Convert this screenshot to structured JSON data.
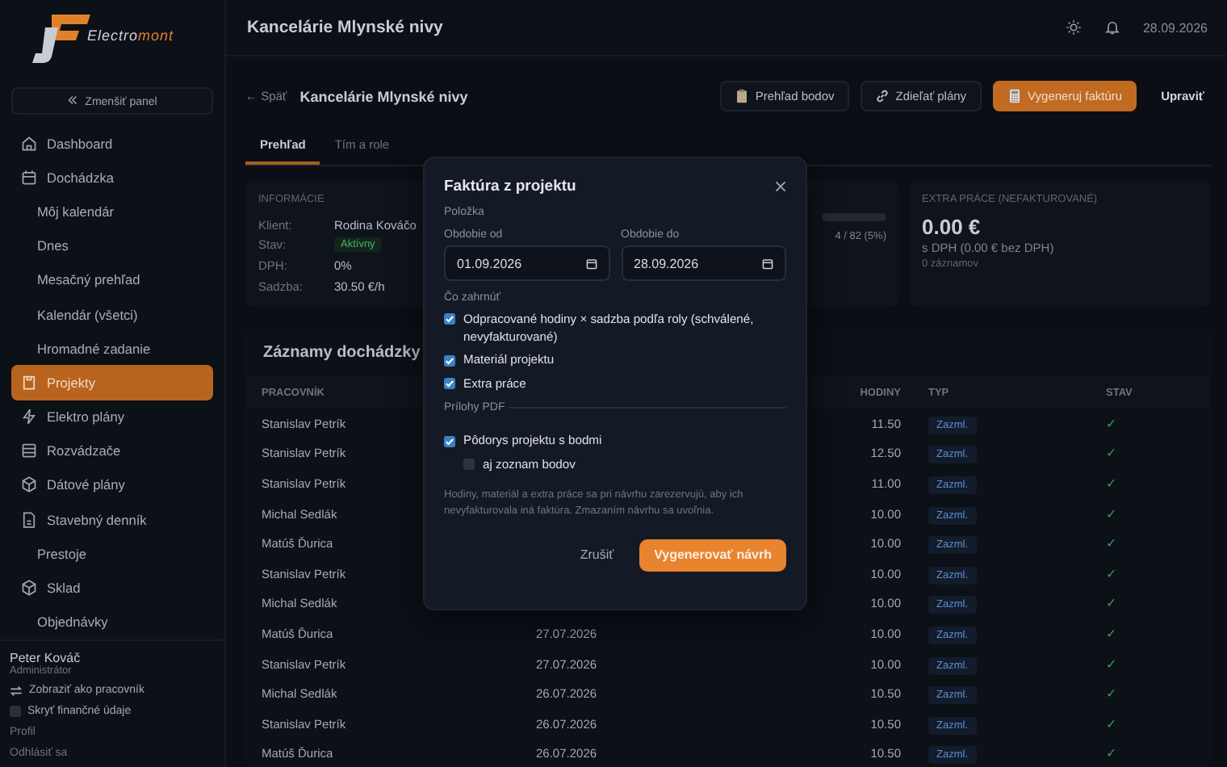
{
  "logo": {
    "name_start": "Electro",
    "name_end": "mont"
  },
  "sidebar": {
    "collapse_button": "Zmenšiť panel",
    "items": [
      {
        "label": "Dashboard",
        "kind": "section",
        "selected": false
      },
      {
        "label": "Dochádzka",
        "kind": "section",
        "selected": false
      },
      {
        "label": "Môj kalendár",
        "kind": "sub",
        "selected": false
      },
      {
        "label": "Dnes",
        "kind": "sub",
        "selected": false
      },
      {
        "label": "Mesačný prehľad",
        "kind": "sub",
        "selected": false
      },
      {
        "label": "Kalendár (všetci)",
        "kind": "sub",
        "selected": false
      },
      {
        "label": "Hromadné zadanie",
        "kind": "sub",
        "selected": false
      },
      {
        "label": "Projekty",
        "kind": "section",
        "selected": true
      },
      {
        "label": "Elektro plány",
        "kind": "section",
        "selected": false
      },
      {
        "label": "Rozvádzače",
        "kind": "section",
        "selected": false
      },
      {
        "label": "Dátové plány",
        "kind": "section",
        "selected": false
      },
      {
        "label": "Stavebný denník",
        "kind": "section",
        "selected": false
      },
      {
        "label": "Prestoje",
        "kind": "sub",
        "selected": false
      },
      {
        "label": "Sklad",
        "kind": "section",
        "selected": false
      },
      {
        "label": "Objednávky",
        "kind": "sub",
        "selected": false
      }
    ],
    "user": {
      "name": "Peter Kováč",
      "role": "Administrátor",
      "switch_link": "Zobraziť ako pracovník",
      "hide_finance": {
        "label": "Skryť finančné údaje",
        "checked": false
      },
      "profile_link": "Profil",
      "logout_link": "Odhlásiť sa"
    }
  },
  "topbar": {
    "title": "Kancelárie Mlynské nivy",
    "date": "28.09.2026"
  },
  "header": {
    "back": "← Späť",
    "title": "Kancelárie Mlynské nivy",
    "buttons": [
      {
        "label": "Prehľad bodov",
        "kind": "clipboard"
      },
      {
        "label": "Zdieľať plány",
        "kind": "link"
      },
      {
        "label": "Vygeneruj faktúru",
        "kind": "primary"
      },
      {
        "label": "Upraviť",
        "kind": "plain"
      }
    ]
  },
  "tabs": [
    {
      "label": "Prehľad",
      "selected": true
    },
    {
      "label": "Tím a role",
      "selected": false
    }
  ],
  "info_card": {
    "heading": "INFORMÁCIE",
    "rows": [
      {
        "label": "Klient:",
        "value": "Rodina Kováčo",
        "kind": "text"
      },
      {
        "label": "Stav:",
        "value": "Aktívny",
        "kind": "badge"
      },
      {
        "label": "DPH:",
        "value": "0%",
        "kind": "text"
      },
      {
        "label": "Sadzba:",
        "value": "30.50 €/h",
        "kind": "text"
      }
    ]
  },
  "progress_card": {
    "caption": "4 / 82 (5%)"
  },
  "extra_card": {
    "heading": "EXTRA PRÁCE (NEFAKTUROVANÉ)",
    "amount": "0.00 €",
    "sub": "s DPH (0.00 € bez DPH)",
    "count": "0 záznamov"
  },
  "table": {
    "title": "Záznamy dochádzky",
    "columns": [
      "PRACOVNÍK",
      "HODINY",
      "TYP",
      "STAV"
    ],
    "rows": [
      {
        "worker": "Stanislav Petrík",
        "hours": "11.50",
        "type": "Zazml.",
        "status": "✓"
      },
      {
        "worker": "Stanislav Petrík",
        "hours": "12.50",
        "type": "Zazml.",
        "status": "✓"
      },
      {
        "worker": "Stanislav Petrík",
        "hours": "11.00",
        "type": "Zazml.",
        "status": "✓"
      },
      {
        "worker": "Michal Sedlák",
        "hours": "10.00",
        "type": "Zazml.",
        "status": "✓"
      },
      {
        "worker": "Matúš Ďurica",
        "hours": "10.00",
        "type": "Zazml.",
        "status": "✓"
      },
      {
        "worker": "Stanislav Petrík",
        "hours": "10.00",
        "type": "Zazml.",
        "status": "✓"
      },
      {
        "worker": "Michal Sedlák",
        "hours": "10.00",
        "type": "Zazml.",
        "status": "✓"
      },
      {
        "worker": "Matúš Ďurica",
        "date": "27.07.2026",
        "hours": "10.00",
        "type": "Zazml.",
        "status": "✓"
      },
      {
        "worker": "Stanislav Petrík",
        "date": "27.07.2026",
        "hours": "10.00",
        "type": "Zazml.",
        "status": "✓"
      },
      {
        "worker": "Michal Sedlák",
        "date": "26.07.2026",
        "hours": "10.50",
        "type": "Zazml.",
        "status": "✓"
      },
      {
        "worker": "Stanislav Petrík",
        "date": "26.07.2026",
        "hours": "10.50",
        "type": "Zazml.",
        "status": "✓"
      },
      {
        "worker": "Matúš Ďurica",
        "date": "26.07.2026",
        "hours": "10.50",
        "type": "Zazml.",
        "status": "✓"
      }
    ]
  },
  "modal": {
    "title": "Faktúra z projektu",
    "section_item": "Položka",
    "date_from": {
      "label": "Obdobie od",
      "value": "01.09.2026"
    },
    "date_to": {
      "label": "Obdobie do",
      "value": "28.09.2026"
    },
    "include_heading": "Čo zahrnúť",
    "include": [
      {
        "label": "Odpracované hodiny × sadzba podľa roly (schválené, nevyfakturované)",
        "checked": true
      },
      {
        "label": "Materiál projektu",
        "checked": true
      },
      {
        "label": "Extra práce",
        "checked": true
      }
    ],
    "attachments_heading": "Prílohy PDF",
    "attachments": [
      {
        "label": "Pôdorys projektu s bodmi",
        "checked": true,
        "kind": "main"
      },
      {
        "label": "aj zoznam bodov",
        "checked": false,
        "kind": "nested"
      }
    ],
    "note": "Hodiny, materiál a extra práce sa pri návrhu zarezervujú, aby ich nevyfakturovala iná faktúra. Zmazaním návrhu sa uvoľnia.",
    "cancel": "Zrušiť",
    "submit": "Vygenerovať návrh"
  }
}
